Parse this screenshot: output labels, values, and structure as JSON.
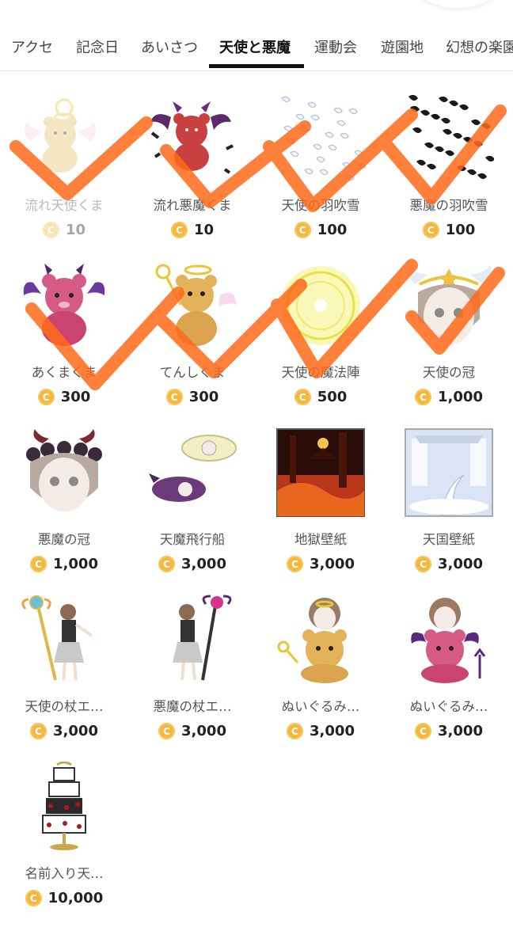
{
  "tabs": [
    {
      "label": "アクセ"
    },
    {
      "label": "記念日"
    },
    {
      "label": "あいさつ"
    },
    {
      "label": "天使と悪魔",
      "active": true
    },
    {
      "label": "運動会"
    },
    {
      "label": "遊園地"
    },
    {
      "label": "幻想の楽園"
    }
  ],
  "coin_symbol": "C",
  "items": [
    {
      "name": "流れ天使くま",
      "price": "10",
      "icon": "angel-bear-stream-icon",
      "faded": true
    },
    {
      "name": "流れ悪魔くま",
      "price": "10",
      "icon": "devil-bear-stream-icon"
    },
    {
      "name": "天使の羽吹雪",
      "price": "100",
      "icon": "white-feathers-icon"
    },
    {
      "name": "悪魔の羽吹雪",
      "price": "100",
      "icon": "black-feathers-icon"
    },
    {
      "name": "あくまくま",
      "price": "300",
      "icon": "devil-bear-icon"
    },
    {
      "name": "てんしくま",
      "price": "300",
      "icon": "angel-bear-icon"
    },
    {
      "name": "天使の魔法陣",
      "price": "500",
      "icon": "magic-circle-icon"
    },
    {
      "name": "天使の冠",
      "price": "1,000",
      "icon": "angel-crown-icon"
    },
    {
      "name": "悪魔の冠",
      "price": "1,000",
      "icon": "devil-crown-icon"
    },
    {
      "name": "天魔飛行船",
      "price": "3,000",
      "icon": "airship-icon"
    },
    {
      "name": "地獄壁紙",
      "price": "3,000",
      "icon": "hell-wallpaper-icon"
    },
    {
      "name": "天国壁紙",
      "price": "3,000",
      "icon": "heaven-wallpaper-icon"
    },
    {
      "name": "天使の杖エ…",
      "price": "3,000",
      "icon": "angel-staff-icon"
    },
    {
      "name": "悪魔の杖エ…",
      "price": "3,000",
      "icon": "devil-staff-icon"
    },
    {
      "name": "ぬいぐるみ…",
      "price": "3,000",
      "icon": "plush-angel-icon"
    },
    {
      "name": "ぬいぐるみ…",
      "price": "3,000",
      "icon": "plush-devil-icon"
    },
    {
      "name": "名前入り天…",
      "price": "10,000",
      "icon": "cake-tower-icon"
    }
  ],
  "colors": {
    "check_stroke": "#ff6a1a",
    "coin": "#f4b73f",
    "active_tab": "#111111"
  }
}
